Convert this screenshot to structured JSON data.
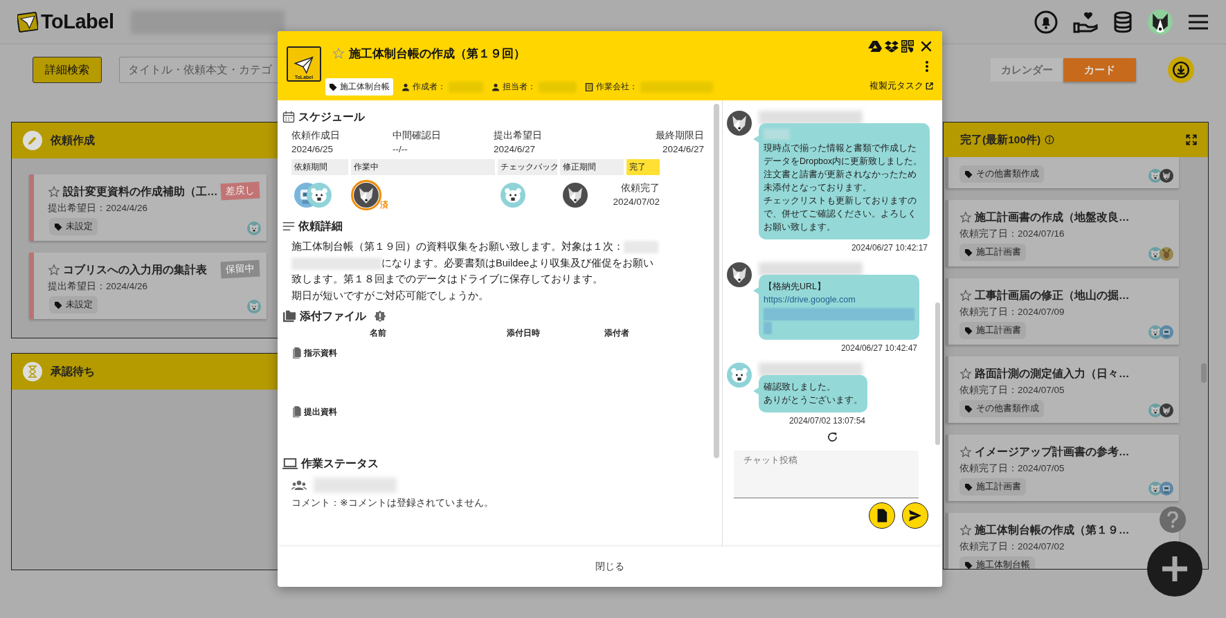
{
  "app_header": {
    "logo": "ToLabel",
    "avatar": {
      "kind": "dog"
    }
  },
  "toolbar": {
    "search_button": "詳細検索",
    "search": {
      "placeholder": "タイトル・依頼本文・カテゴ"
    },
    "view_tabs": [
      {
        "label": "カレンダー",
        "selected": false
      },
      {
        "label": "カード",
        "selected": true
      }
    ]
  },
  "columns": [
    {
      "title": "依頼作成",
      "cards": [
        {
          "title": "設計変更資料の作成補助（工…",
          "starred": false,
          "date": "提出希望日：2024/4/26",
          "status": "差戻し",
          "color": "#c27474",
          "tag": "未設定",
          "avatars": [
            {
              "kind": "bear"
            }
          ]
        },
        {
          "title": "コブリスへの入力用の集計表",
          "starred": false,
          "date": "提出希望日：2024/4/26",
          "status": "保留中",
          "color": "#8a8a8a",
          "tag": "未設定",
          "avatars": [
            {
              "kind": "bear"
            }
          ]
        }
      ]
    },
    {
      "title": "承認待ち"
    }
  ],
  "completed_column": {
    "title": "完了(最新100件)",
    "cards": [
      {
        "tag": "その他書類作成",
        "avatars": [
          {
            "kind": "bear"
          },
          {
            "kind": "wolf"
          }
        ]
      },
      {
        "title": "施工計画書の作成（地盤改良…",
        "starred": false,
        "date": "依頼完了日：2024/07/16",
        "tag": "施工計画書",
        "avatars": [
          {
            "kind": "bear"
          },
          {
            "kind": "deer"
          }
        ]
      },
      {
        "title": "工事計画届の修正（地山の掘…",
        "starred": false,
        "date": "依頼完了日：2024/07/09",
        "tag": "施工計画書",
        "avatars": [
          {
            "kind": "bear"
          },
          {
            "kind": "robot"
          }
        ]
      },
      {
        "title": "路面計測の測定値入力（日々…",
        "starred": false,
        "date": "依頼完了日：2024/07/05",
        "tag": "その他書類作成",
        "avatars": [
          {
            "kind": "bear"
          },
          {
            "kind": "wolf"
          }
        ]
      },
      {
        "title": "イメージアップ計画書の参考…",
        "starred": false,
        "date": "依頼完了日：2024/07/05",
        "tag": "施工計画書",
        "avatars": [
          {
            "kind": "bear"
          },
          {
            "kind": "robot"
          }
        ]
      },
      {
        "title": "施工体制台帳の作成（第１９…",
        "starred": false,
        "date": "依頼完了日：2024/07/02",
        "tag": "施工体制台帳"
      }
    ]
  },
  "modal": {
    "logo": "ToLabel",
    "starred": false,
    "title": "施工体制台帳の作成（第１９回）",
    "tag": "施工体制台帳",
    "meta": [
      {
        "kind": "person",
        "label": "作成者："
      },
      {
        "kind": "person",
        "label": "担当者："
      },
      {
        "kind": "company",
        "label": "作業会社："
      }
    ],
    "source_link": "複製元タスク",
    "schedule": {
      "heading": "スケジュール",
      "dates": [
        {
          "label": "依頼作成日",
          "value": "2024/6/25"
        },
        {
          "label": "中間確認日",
          "value": "--/--"
        },
        {
          "label": "提出希望日",
          "value": "2024/6/27"
        },
        {
          "label": "最終期限日",
          "value": "2024/6/27"
        }
      ],
      "phases": [
        {
          "label": "依頼期間",
          "selected": false
        },
        {
          "label": "作業中",
          "selected": false
        },
        {
          "label": "チェックバック",
          "selected": false
        },
        {
          "label": "修正期間",
          "selected": false
        },
        {
          "label": "完了",
          "selected": true
        }
      ],
      "assignees": [
        {
          "avatars": [
            {
              "kind": "robot"
            },
            {
              "kind": "bear"
            }
          ],
          "done": false
        },
        {
          "avatars": [
            {
              "kind": "wolf"
            }
          ],
          "done": true,
          "done_label": "済"
        },
        {
          "avatars": [
            {
              "kind": "bear"
            }
          ],
          "done": false
        },
        {
          "avatars": [
            {
              "kind": "wolf"
            }
          ],
          "done": false
        }
      ],
      "completion": {
        "label": "依頼完了",
        "date": "2024/07/02"
      }
    },
    "detail": {
      "heading": "依頼詳細",
      "text_before": "施工体制台帳（第１９回）の資料収集をお願い致します。対象は１次：",
      "text_after": "になります。必要書類はBuildeeより収集及び催促をお願い致します。第１８回までのデータはドライブに保存しております。",
      "last_line": "期日が短いですがご対応可能でしょうか。"
    },
    "attachments": {
      "heading": "添付ファイル",
      "columns": [
        "名前",
        "添付日時",
        "添付者"
      ],
      "groups": [
        "指示資料",
        "提出資料"
      ]
    },
    "work_status": {
      "heading": "作業ステータス",
      "comment": "コメント：※コメントは登録されていません。"
    },
    "close_button": "閉じる"
  },
  "chat": {
    "messages": [
      {
        "avatar": {
          "kind": "wolf"
        },
        "redacted_prefix": true,
        "lines": [
          "現時点で揃った情報と書類で作成したデータをDropbox内に更新致しました。",
          "注文書と請書が更新されなかったため未添付となっております。",
          "チェックリストも更新しておりますので、併せてご確認ください。よろしくお願い致します。"
        ],
        "time": "2024/06/27 10:42:17"
      },
      {
        "avatar": {
          "kind": "wolf"
        },
        "lines": [
          "【格納先URL】"
        ],
        "link": "https://drive.google.com",
        "time": "2024/06/27 10:42:47"
      },
      {
        "avatar": {
          "kind": "bear"
        },
        "lines": [
          "確認致しました。",
          "ありがとうございます。"
        ],
        "time": "2024/07/02 13:07:54"
      }
    ],
    "input": {
      "placeholder": "チャット投稿"
    }
  }
}
